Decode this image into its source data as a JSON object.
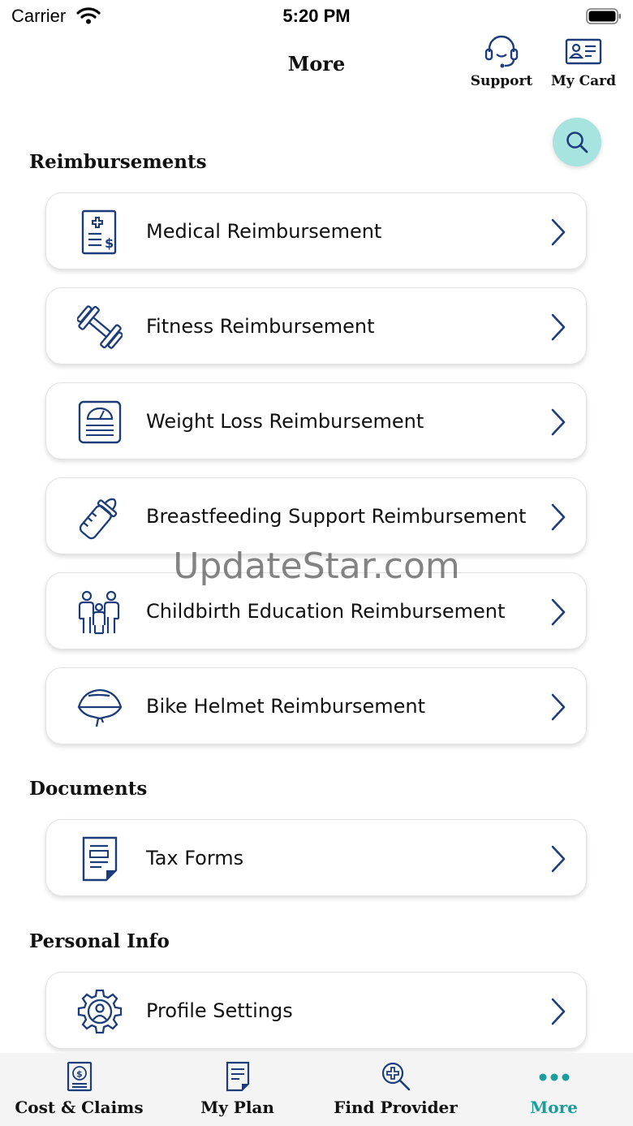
{
  "status_bar": {
    "carrier": "Carrier",
    "time": "5:20 PM"
  },
  "header": {
    "title": "More",
    "actions": [
      {
        "label": "Support",
        "icon": "headset-icon"
      },
      {
        "label": "My Card",
        "icon": "id-card-icon"
      }
    ]
  },
  "sections": {
    "reimbursements": {
      "title": "Reimbursements",
      "items": [
        {
          "label": "Medical Reimbursement",
          "icon": "medical-bill-icon"
        },
        {
          "label": "Fitness Reimbursement",
          "icon": "dumbbell-icon"
        },
        {
          "label": "Weight Loss Reimbursement",
          "icon": "scale-icon"
        },
        {
          "label": "Breastfeeding Support Reimbursement",
          "icon": "baby-bottle-icon"
        },
        {
          "label": "Childbirth Education Reimbursement",
          "icon": "family-icon"
        },
        {
          "label": "Bike Helmet Reimbursement",
          "icon": "helmet-icon"
        }
      ]
    },
    "documents": {
      "title": "Documents",
      "items": [
        {
          "label": "Tax Forms",
          "icon": "document-icon"
        }
      ]
    },
    "personal_info": {
      "title": "Personal Info",
      "items": [
        {
          "label": "Profile Settings",
          "icon": "profile-gear-icon"
        }
      ]
    }
  },
  "watermark": "UpdateStar.com",
  "tab_bar": {
    "tabs": [
      {
        "label": "Cost & Claims",
        "icon": "claims-icon"
      },
      {
        "label": "My Plan",
        "icon": "plan-icon"
      },
      {
        "label": "Find Provider",
        "icon": "find-provider-icon"
      },
      {
        "label": "More",
        "icon": "more-dots-icon",
        "active": true
      }
    ]
  },
  "colors": {
    "icon_navy": "#1d3d7a",
    "accent_teal": "#1a9e9c",
    "fab_bg": "#a7e3df"
  }
}
